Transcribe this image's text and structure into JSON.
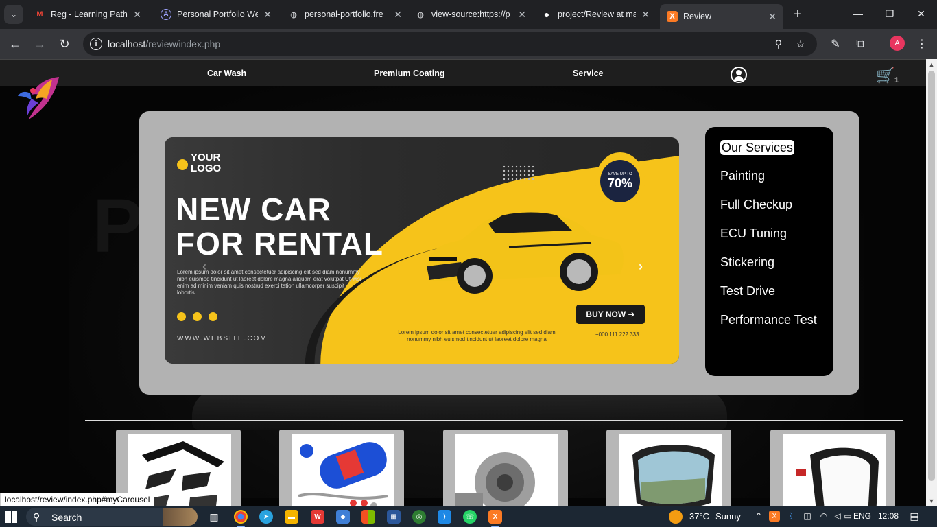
{
  "browser": {
    "tabs": [
      {
        "title": "Reg - Learning Paths |",
        "favicon": "gmail-icon",
        "favicon_glyph": "M"
      },
      {
        "title": "Personal Portfolio We",
        "favicon": "portfolio-icon",
        "favicon_glyph": "A"
      },
      {
        "title": "personal-portfolio.fre",
        "favicon": "globe-icon",
        "favicon_glyph": "◍"
      },
      {
        "title": "view-source:https://p",
        "favicon": "globe-icon",
        "favicon_glyph": "◍"
      },
      {
        "title": "project/Review at ma",
        "favicon": "github-icon",
        "favicon_glyph": "●"
      },
      {
        "title": "Review",
        "favicon": "xampp-icon",
        "favicon_glyph": "X"
      }
    ],
    "url_host": "localhost",
    "url_path": "/review/index.php",
    "profile_initial": "A",
    "status_url": "localhost/review/index.php#myCarousel"
  },
  "nav": {
    "links": [
      "Car Wash",
      "Premium Coating",
      "Service"
    ],
    "cart_count": "1"
  },
  "banner": {
    "logo_text": "YOUR LOGO",
    "title_line1": "NEW CAR",
    "title_line2": "FOR RENTAL",
    "body": "Lorem ipsum dolor sit amet consectetuer adipiscing elit sed diam nonummy nibh euismod tincidunt ut laoreet dolore magna aliquam erat volutpat Ut wisi enim ad minim veniam quis nostrud exerci tation ullamcorper suscipit lobortis",
    "website": "WWW.WEBSITE.COM",
    "badge_small": "SAVE UP TO",
    "badge_big": "70%",
    "buy_label": "BUY NOW",
    "phone": "+000 111 222 333",
    "footer_text": "Lorem ipsum dolor sit amet consectetuer adipiscing elit sed diam nonummy nibh euismod tincidunt ut laoreet dolore magna"
  },
  "services": {
    "title": "Our Services",
    "items": [
      "Painting",
      "Full Checkup",
      "ECU Tuning",
      "Stickering",
      "Test Drive",
      "Performance Test"
    ]
  },
  "products": [
    {
      "name": "spoiler-kit"
    },
    {
      "name": "nos-bottle"
    },
    {
      "name": "turbocharger"
    },
    {
      "name": "side-mirror-glass"
    },
    {
      "name": "side-mirror"
    }
  ],
  "taskbar": {
    "search_placeholder": "Search",
    "temperature": "37°C",
    "weather": "Sunny",
    "language": "ENG",
    "time": "12:08"
  },
  "colors": {
    "accent_yellow": "#f6c31a",
    "hero_bg": "#b2b2b2",
    "nav_bg": "#1e1e1e"
  }
}
